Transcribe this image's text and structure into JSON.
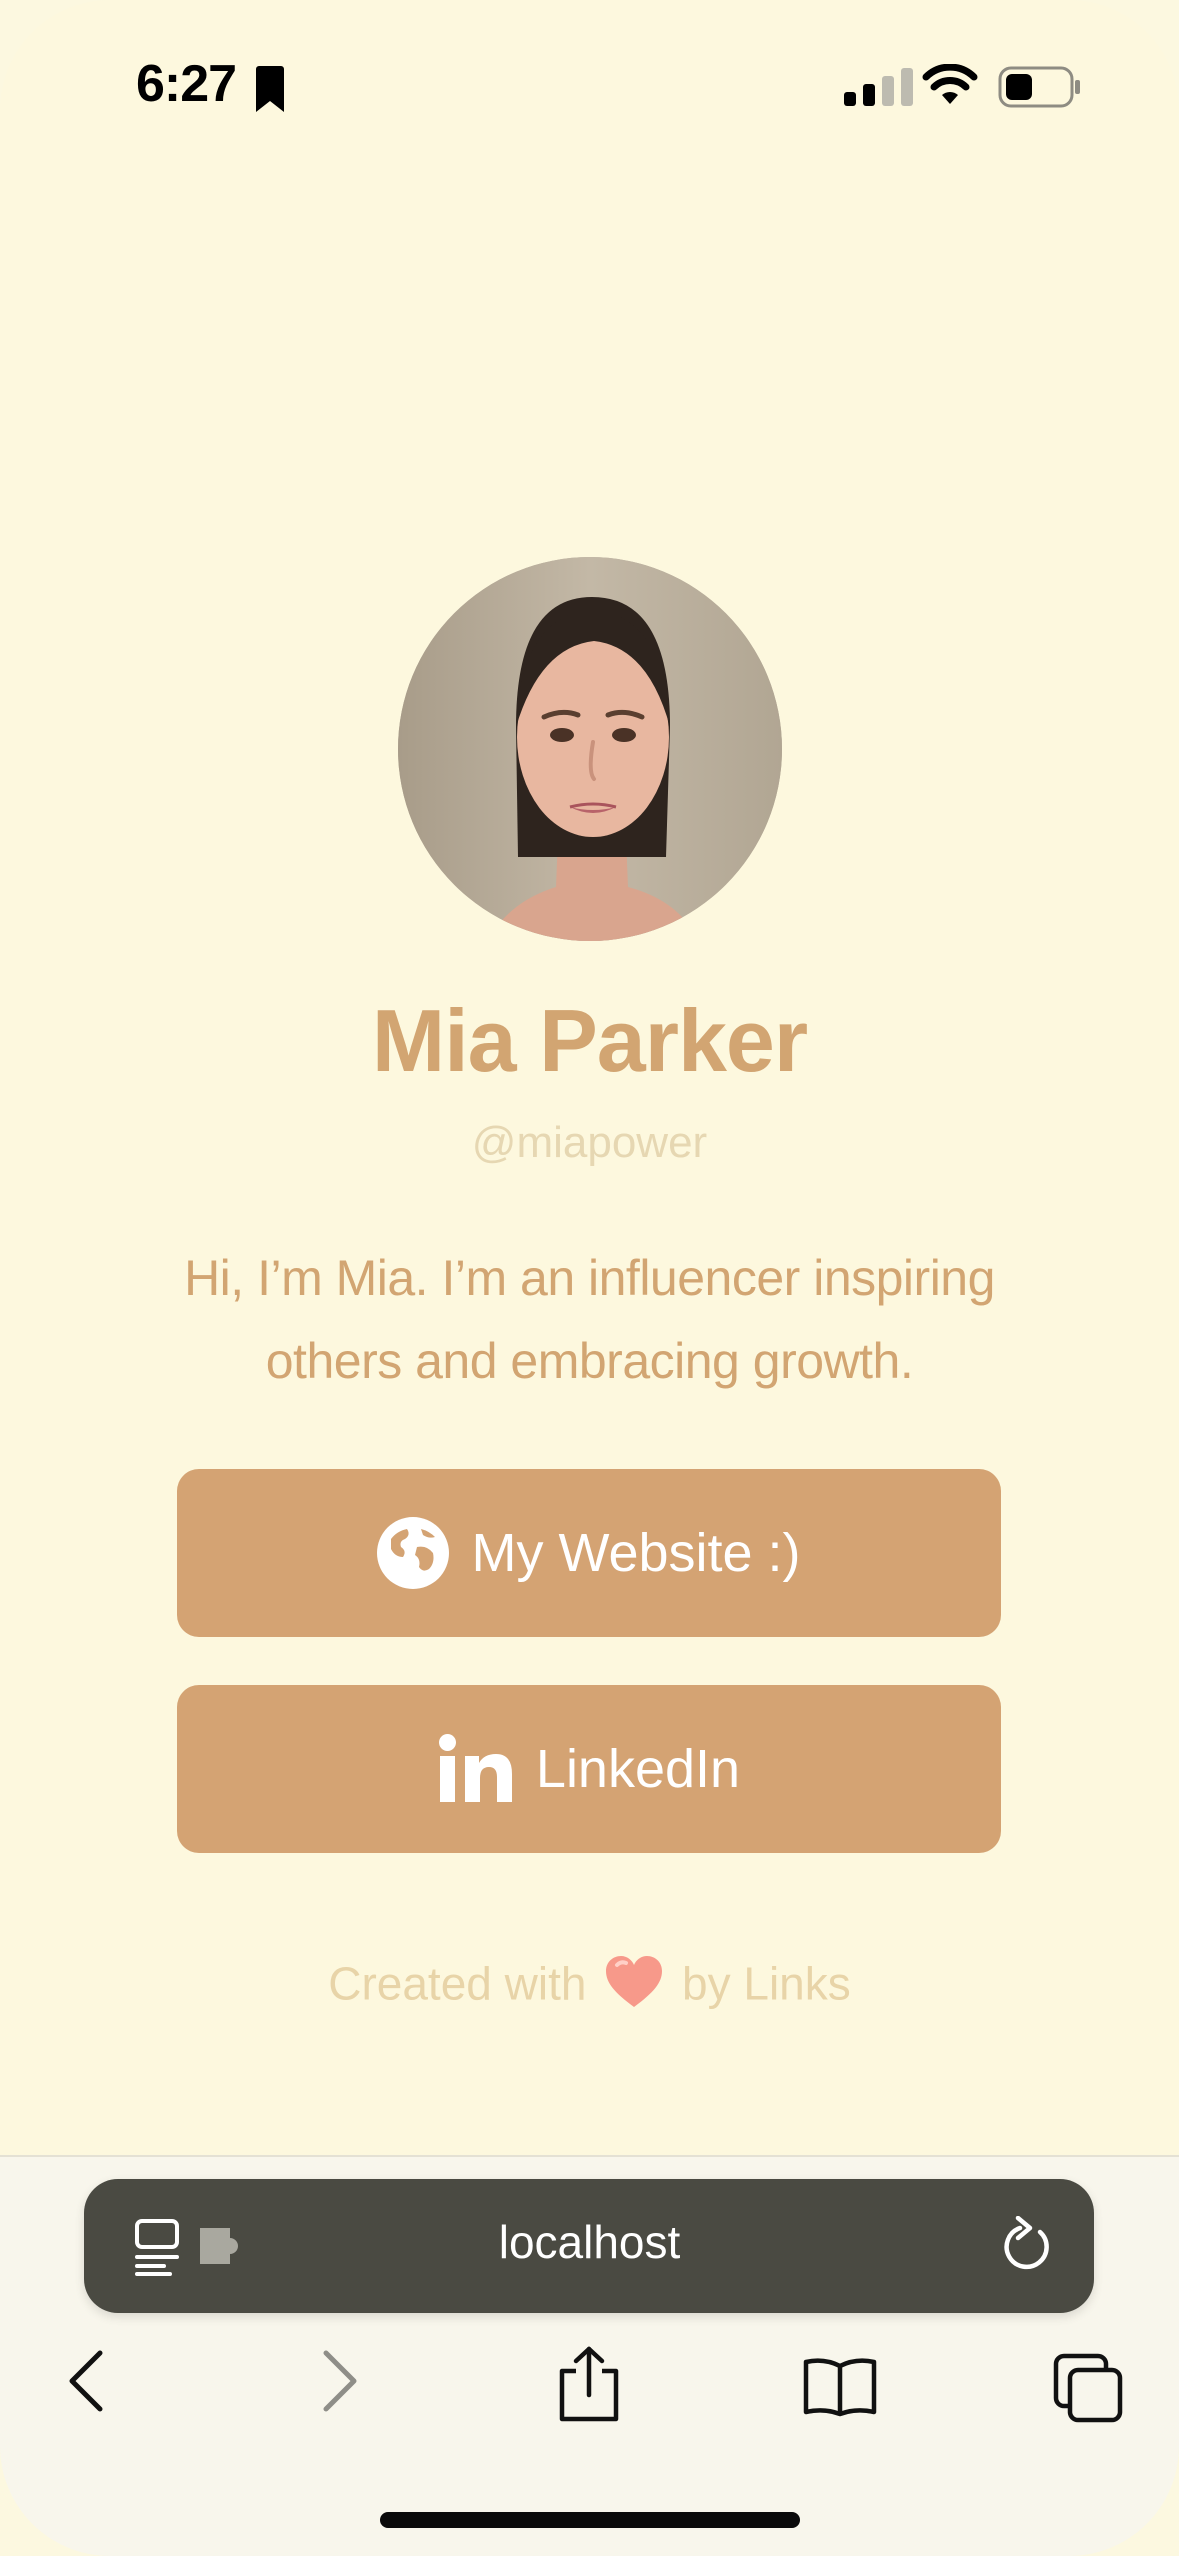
{
  "status": {
    "time": "6:27"
  },
  "profile": {
    "name": "Mia Parker",
    "handle": "@miapower",
    "bio_line1": "Hi, I’m Mia. I’m an influencer inspiring",
    "bio_line2": "others and embracing growth."
  },
  "links": [
    {
      "label": "My Website :)",
      "icon": "globe-icon"
    },
    {
      "label": "LinkedIn",
      "icon": "linkedin-icon"
    }
  ],
  "footer": {
    "prefix": "Created with",
    "suffix": "by Links",
    "icon": "heart-icon"
  },
  "browser": {
    "url": "localhost"
  },
  "colors": {
    "background": "#FDF8DE",
    "accent": "#D4A373",
    "name_text": "#D2A572",
    "muted_text": "#E6D7B2",
    "url_bar": "#4A4A42"
  }
}
